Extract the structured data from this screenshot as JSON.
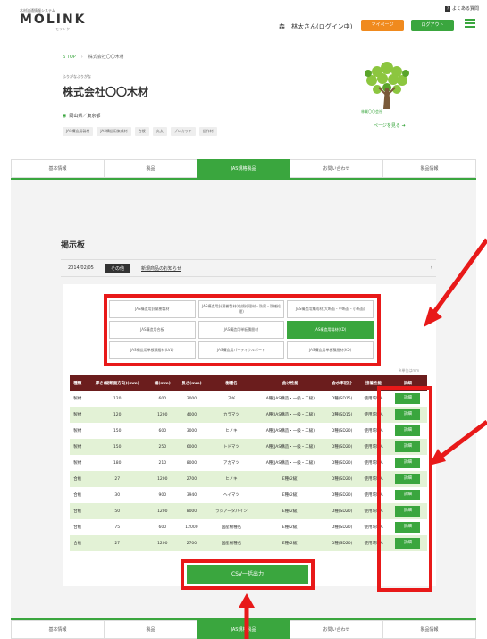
{
  "header": {
    "logo_sub": "木材流通情報システム",
    "logo": "MOLINK",
    "logo_tag": "モリンク",
    "user_label": "森　林太さん(ログイン中)",
    "btn_mypage": "マイページ",
    "btn_logout": "ログアウト",
    "help": "よくある質問"
  },
  "breadcrumb": {
    "top": "TOP",
    "current": "株式会社〇〇木材"
  },
  "company": {
    "kana": "ふりがなふりがな",
    "name": "株式会社〇〇木材",
    "address": "岡山県／東京都",
    "tags": [
      "JAS構造用製材",
      "JAS構造用集成材",
      "合板",
      "丸太",
      "プレカット",
      "造作材"
    ]
  },
  "tree": {
    "caption": "林業〇〇会社",
    "link": "ページを見る"
  },
  "tabs": [
    "基本情報",
    "製品",
    "JAS規格製品",
    "お問い合わせ",
    "製品情報"
  ],
  "active_tab": 2,
  "board": {
    "title": "掲示板",
    "news_date": "2014/02/05",
    "news_badge": "その他",
    "news_text": "新規商品のお知らせ",
    "news_arrow": "›"
  },
  "filters": [
    "JAS構造用針葉樹製材",
    "JAS構造用針葉樹製材(乾燥処理材・防腐・防蟻処理)",
    "JAS構造用集成材(大断面・中断面・小断面)",
    "JAS構造用合板",
    "JAS構造用単板積層材",
    "JAS構造用製材(KD)",
    "JAS構造用単板積層材(LVL)",
    "JAS構造用パーティクルボード",
    "JAS構造用単板積層材(KD)"
  ],
  "active_filter": 5,
  "table": {
    "note": "※単位はmm",
    "headers": [
      "種類",
      "厚さ(縦断面方向)(mm)",
      "幅(mm)",
      "長さ(mm)",
      "樹種名",
      "曲げ性能",
      "含水率区分",
      "接着性能",
      "詳細"
    ],
    "rows": [
      [
        "製材",
        "120",
        "600",
        "3000",
        "スギ",
        "A種(JAS構造・一級・二級)",
        "D種(SD15)",
        "使用環境A",
        "詳細"
      ],
      [
        "製材",
        "120",
        "1200",
        "4000",
        "カラマツ",
        "A種(JAS構造・一級・二級)",
        "D種(SD15)",
        "使用環境A",
        "詳細"
      ],
      [
        "製材",
        "150",
        "600",
        "3000",
        "ヒノキ",
        "A種(JAS構造・一級・二級)",
        "D種(SD20)",
        "使用環境A",
        "詳細"
      ],
      [
        "製材",
        "150",
        "250",
        "6000",
        "トドマツ",
        "A種(JAS構造・一級・二級)",
        "D種(SD20)",
        "使用環境A",
        "詳細"
      ],
      [
        "製材",
        "180",
        "210",
        "8000",
        "アカマツ",
        "A種(JAS構造・一級・二級)",
        "D種(SD20)",
        "使用環境A",
        "詳細"
      ],
      [
        "合板",
        "27",
        "1200",
        "2700",
        "ヒノキ",
        "E種(2級)",
        "D種(SD20)",
        "使用環境A",
        "詳細"
      ],
      [
        "合板",
        "30",
        "900",
        "3940",
        "ヘイマツ",
        "E種(2級)",
        "D種(SD20)",
        "使用環境A",
        "詳細"
      ],
      [
        "合板",
        "50",
        "1200",
        "8000",
        "ラジアータパイン",
        "E種(2級)",
        "D種(SD20)",
        "使用環境A",
        "詳細"
      ],
      [
        "合板",
        "75",
        "600",
        "12000",
        "国産樹種名",
        "E種(2級)",
        "D種(SD20)",
        "使用環境A",
        "詳細"
      ],
      [
        "合板",
        "27",
        "1200",
        "2700",
        "国産樹種名",
        "E種(2級)",
        "D種(SD20)",
        "使用環境A",
        "詳細"
      ]
    ]
  },
  "csv_button": "CSV一括出力",
  "colors": {
    "accent": "#3aa63e",
    "table_header": "#6b1d1d",
    "highlight_red": "#e81919",
    "row_alt": "#e3f2d6"
  }
}
